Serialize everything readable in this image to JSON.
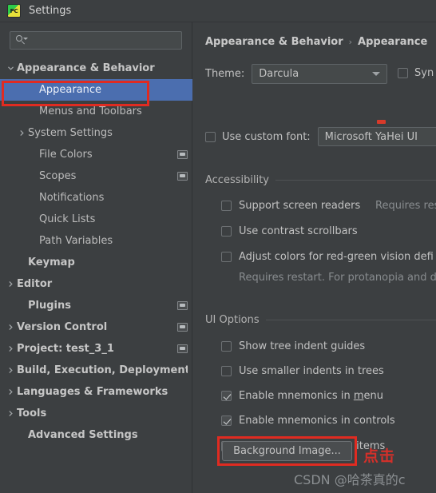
{
  "window": {
    "title": "Settings",
    "app_icon": "pycharm-pc-icon"
  },
  "sidebar": {
    "search": {
      "value": "",
      "placeholder": "",
      "icon": "search-icon"
    },
    "tree": [
      {
        "label": "Appearance & Behavior",
        "indent": 0,
        "twisty": "down",
        "bold": true,
        "selected": false,
        "badge": false
      },
      {
        "label": "Appearance",
        "indent": 2,
        "twisty": "none",
        "bold": false,
        "selected": true,
        "badge": false
      },
      {
        "label": "Menus and Toolbars",
        "indent": 2,
        "twisty": "none",
        "bold": false,
        "selected": false,
        "badge": false
      },
      {
        "label": "System Settings",
        "indent": 1,
        "twisty": "right",
        "bold": false,
        "selected": false,
        "badge": false
      },
      {
        "label": "File Colors",
        "indent": 2,
        "twisty": "none",
        "bold": false,
        "selected": false,
        "badge": true
      },
      {
        "label": "Scopes",
        "indent": 2,
        "twisty": "none",
        "bold": false,
        "selected": false,
        "badge": true
      },
      {
        "label": "Notifications",
        "indent": 2,
        "twisty": "none",
        "bold": false,
        "selected": false,
        "badge": false
      },
      {
        "label": "Quick Lists",
        "indent": 2,
        "twisty": "none",
        "bold": false,
        "selected": false,
        "badge": false
      },
      {
        "label": "Path Variables",
        "indent": 2,
        "twisty": "none",
        "bold": false,
        "selected": false,
        "badge": false
      },
      {
        "label": "Keymap",
        "indent": 1,
        "twisty": "none",
        "bold": true,
        "selected": false,
        "badge": false
      },
      {
        "label": "Editor",
        "indent": 0,
        "twisty": "right",
        "bold": true,
        "selected": false,
        "badge": false
      },
      {
        "label": "Plugins",
        "indent": 1,
        "twisty": "none",
        "bold": true,
        "selected": false,
        "badge": true
      },
      {
        "label": "Version Control",
        "indent": 0,
        "twisty": "right",
        "bold": true,
        "selected": false,
        "badge": true
      },
      {
        "label": "Project: test_3_1",
        "indent": 0,
        "twisty": "right",
        "bold": true,
        "selected": false,
        "badge": true
      },
      {
        "label": "Build, Execution, Deployment",
        "indent": 0,
        "twisty": "right",
        "bold": true,
        "selected": false,
        "badge": false
      },
      {
        "label": "Languages & Frameworks",
        "indent": 0,
        "twisty": "right",
        "bold": true,
        "selected": false,
        "badge": false
      },
      {
        "label": "Tools",
        "indent": 0,
        "twisty": "right",
        "bold": true,
        "selected": false,
        "badge": false
      },
      {
        "label": "Advanced Settings",
        "indent": 1,
        "twisty": "none",
        "bold": true,
        "selected": false,
        "badge": false
      }
    ]
  },
  "main": {
    "breadcrumb": {
      "parent": "Appearance & Behavior",
      "separator": "›",
      "current": "Appearance"
    },
    "theme": {
      "label": "Theme:",
      "value": "Darcula"
    },
    "sync_checkbox": {
      "label": "Syn",
      "checked": false
    },
    "custom_font": {
      "label": "Use custom font:",
      "checked": false,
      "value": "Microsoft YaHei UI"
    },
    "accessibility": {
      "title": "Accessibility",
      "options": [
        {
          "label": "Support screen readers",
          "checked": false,
          "hint": "Requires res"
        },
        {
          "label": "Use contrast scrollbars",
          "checked": false,
          "hint": ""
        },
        {
          "label": "Adjust colors for red-green vision defi",
          "checked": false,
          "hint": ""
        }
      ],
      "note": "Requires restart. For protanopia and d"
    },
    "ui_options": {
      "title": "UI Options",
      "options": [
        {
          "label": "Show tree indent guides",
          "checked": false
        },
        {
          "label": "Use smaller indents in trees",
          "checked": false
        },
        {
          "label_pre": "Enable mnemonics in ",
          "mnemonic": "m",
          "label_post": "enu",
          "checked": true
        },
        {
          "label": "Enable mnemonics in controls",
          "checked": true
        },
        {
          "label": "Display icons in menu items",
          "checked": true
        }
      ],
      "background_image_button": "Background Image..."
    }
  },
  "annotations": {
    "click_note": "点击",
    "watermark": "CSDN @哈茶真的c",
    "highlight_color": "#e02b21"
  }
}
